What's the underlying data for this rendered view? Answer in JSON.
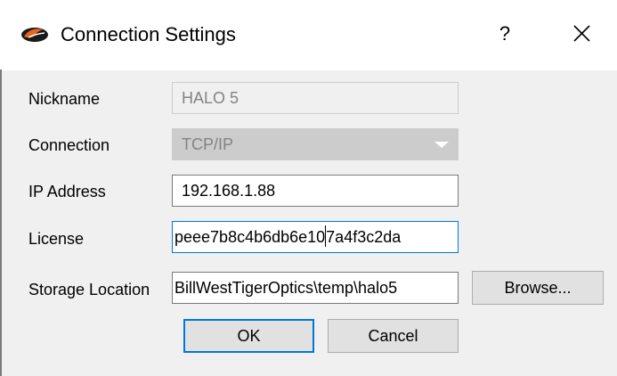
{
  "window": {
    "title": "Connection Settings",
    "help_label": "?",
    "app_icon": "halo-logo-icon",
    "close_icon": "close-icon"
  },
  "form": {
    "nickname": {
      "label": "Nickname",
      "value": "HALO 5"
    },
    "connection": {
      "label": "Connection",
      "value": "TCP/IP"
    },
    "ip_address": {
      "label": "IP Address",
      "value": "192.168.1.88"
    },
    "license": {
      "label": "License",
      "value_before_caret": "peee7b8c4b6db6e10",
      "value_after_caret": "7a4f3c2da"
    },
    "storage_location": {
      "label": "Storage Location",
      "value": "BillWestTigerOptics\\temp\\halo5"
    }
  },
  "buttons": {
    "browse_label": "Browse...",
    "ok_label": "OK",
    "cancel_label": "Cancel"
  },
  "colors": {
    "focus_accent": "#0078d7",
    "disabled_text": "#838383"
  }
}
